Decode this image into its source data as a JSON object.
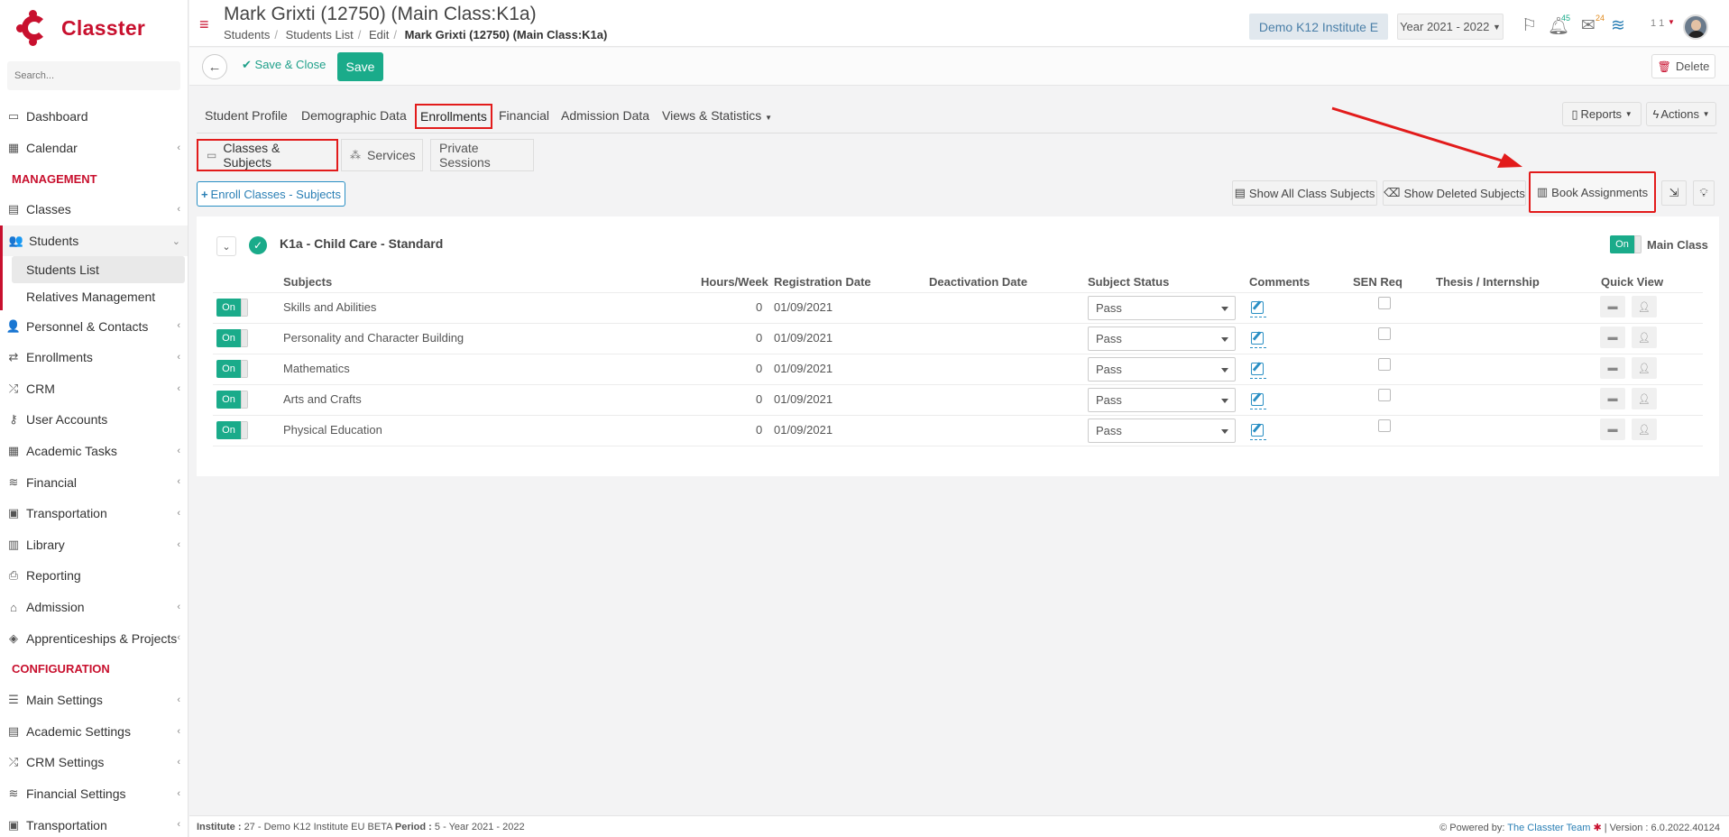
{
  "brand": {
    "name": "Classter",
    "color": "#c8102e"
  },
  "sidebar": {
    "search_placeholder": "Search...",
    "items": [
      {
        "label": "Dashboard",
        "icon": "laptop-icon",
        "chev": false
      },
      {
        "label": "Calendar",
        "icon": "calendar-icon",
        "chev": true
      }
    ],
    "section_management": "MANAGEMENT",
    "management": [
      {
        "label": "Classes",
        "icon": "classes-icon",
        "chev": true
      },
      {
        "label": "Students",
        "icon": "students-icon",
        "chev": true
      }
    ],
    "students_sub": [
      "Students List",
      "Relatives Management"
    ],
    "management2": [
      {
        "label": "Personnel & Contacts",
        "icon": "personnel-icon"
      },
      {
        "label": "Enrollments",
        "icon": "enrollments-icon"
      },
      {
        "label": "CRM",
        "icon": "crm-icon"
      },
      {
        "label": "User Accounts",
        "icon": "key-icon"
      },
      {
        "label": "Academic Tasks",
        "icon": "tasks-icon"
      },
      {
        "label": "Financial",
        "icon": "coins-icon"
      },
      {
        "label": "Transportation",
        "icon": "bus-icon"
      },
      {
        "label": "Library",
        "icon": "library-icon"
      },
      {
        "label": "Reporting",
        "icon": "printer-icon"
      },
      {
        "label": "Admission",
        "icon": "bank-icon"
      },
      {
        "label": "Apprenticeships & Projects",
        "icon": "box-icon"
      }
    ],
    "section_configuration": "CONFIGURATION",
    "configuration": [
      {
        "label": "Main Settings",
        "icon": "sliders-icon"
      },
      {
        "label": "Academic Settings",
        "icon": "classes-icon"
      },
      {
        "label": "CRM Settings",
        "icon": "crm-icon"
      },
      {
        "label": "Financial Settings",
        "icon": "coins-icon"
      },
      {
        "label": "Transportation",
        "icon": "bus-icon"
      }
    ]
  },
  "header": {
    "title": "Mark Grixti (12750) (Main Class:K1a)",
    "breadcrumb": [
      "Students",
      "Students List",
      "Edit"
    ],
    "breadcrumb_current": "Mark Grixti (12750) (Main Class:K1a)",
    "institute": "Demo K12 Institute E",
    "year": "Year 2021 - 2022",
    "notifications_count": "45",
    "messages_count": "24",
    "user_short": "1 1"
  },
  "toolbar": {
    "save_close": "Save & Close",
    "save": "Save",
    "delete": "Delete"
  },
  "tabs": {
    "items": [
      "Student Profile",
      "Demographic Data",
      "Enrollments",
      "Financial",
      "Admission Data",
      "Views & Statistics"
    ],
    "active": "Enrollments",
    "reports": "Reports",
    "actions": "Actions"
  },
  "subtabs": {
    "items": [
      "Classes & Subjects",
      "Services",
      "Private Sessions"
    ],
    "active": "Classes & Subjects"
  },
  "buttons": {
    "enroll": "Enroll Classes - Subjects",
    "show_all": "Show All Class Subjects",
    "show_deleted": "Show Deleted Subjects",
    "book_assignments": "Book Assignments"
  },
  "class_block": {
    "title": "K1a - Child Care - Standard",
    "toggle": "On",
    "main_class_label": "Main Class",
    "columns": [
      "Subjects",
      "Hours/Week",
      "Registration Date",
      "Deactivation Date",
      "Subject Status",
      "Comments",
      "SEN Req",
      "Thesis / Internship",
      "Quick View"
    ],
    "rows": [
      {
        "toggle": "On",
        "subject": "Skills and Abilities",
        "hours": "0",
        "reg_date": "01/09/2021",
        "status": "Pass"
      },
      {
        "toggle": "On",
        "subject": "Personality and Character Building",
        "hours": "0",
        "reg_date": "01/09/2021",
        "status": "Pass"
      },
      {
        "toggle": "On",
        "subject": "Mathematics",
        "hours": "0",
        "reg_date": "01/09/2021",
        "status": "Pass"
      },
      {
        "toggle": "On",
        "subject": "Arts and Crafts",
        "hours": "0",
        "reg_date": "01/09/2021",
        "status": "Pass"
      },
      {
        "toggle": "On",
        "subject": "Physical Education",
        "hours": "0",
        "reg_date": "01/09/2021",
        "status": "Pass"
      }
    ]
  },
  "footer": {
    "institute_label": "Institute :",
    "institute_value": "27 - Demo K12 Institute EU BETA",
    "period_label": "Period :",
    "period_value": "5 - Year 2021 - 2022",
    "powered_by": "Powered by:",
    "team": "The Classter Team",
    "version": "| Version : 6.0.2022.40124"
  },
  "colors": {
    "accent": "#1aab8a",
    "annotation": "#e21b1b",
    "link": "#2a7fb5"
  }
}
